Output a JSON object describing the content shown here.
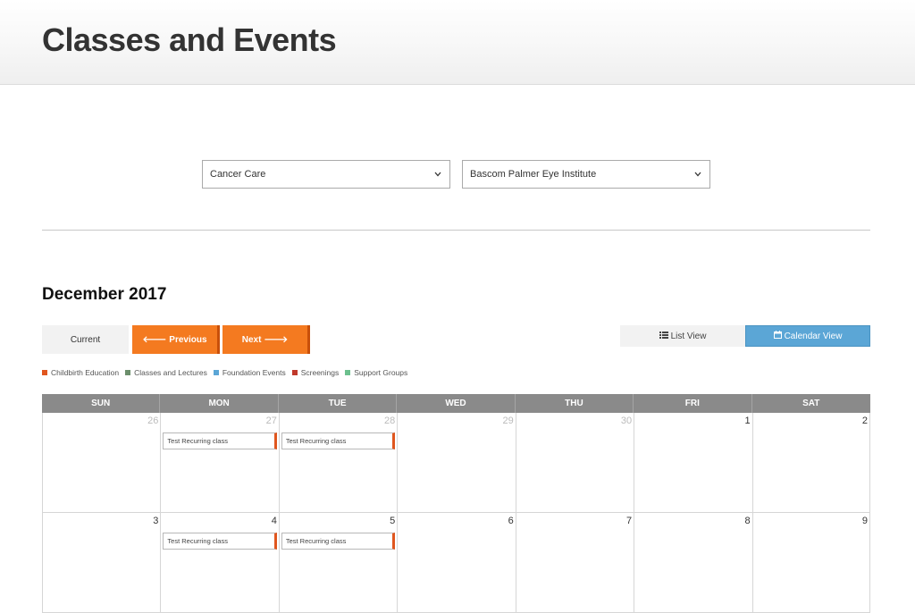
{
  "header": {
    "title": "Classes and Events"
  },
  "filters": {
    "category": "Cancer Care",
    "location": "Bascom Palmer Eye Institute"
  },
  "calendar": {
    "month_title": "December 2017",
    "buttons": {
      "current": "Current",
      "previous": "Previous",
      "next": "Next",
      "list_view": "List View",
      "calendar_view": "Calendar View"
    },
    "legend": [
      {
        "label": "Childbirth Education",
        "color": "#e0561e"
      },
      {
        "label": "Classes and Lectures",
        "color": "#6c8f6c"
      },
      {
        "label": "Foundation Events",
        "color": "#5ba6d6"
      },
      {
        "label": "Screenings",
        "color": "#c0392b"
      },
      {
        "label": "Support Groups",
        "color": "#6cc08e"
      }
    ],
    "weekdays": [
      "SUN",
      "MON",
      "TUE",
      "WED",
      "THU",
      "FRI",
      "SAT"
    ],
    "weeks": [
      [
        {
          "day": "26",
          "muted": true,
          "event": ""
        },
        {
          "day": "27",
          "muted": true,
          "event": "Test Recurring class"
        },
        {
          "day": "28",
          "muted": true,
          "event": "Test Recurring class"
        },
        {
          "day": "29",
          "muted": true,
          "event": ""
        },
        {
          "day": "30",
          "muted": true,
          "event": ""
        },
        {
          "day": "1",
          "muted": false,
          "event": ""
        },
        {
          "day": "2",
          "muted": false,
          "event": ""
        }
      ],
      [
        {
          "day": "3",
          "muted": false,
          "event": ""
        },
        {
          "day": "4",
          "muted": false,
          "event": "Test Recurring class"
        },
        {
          "day": "5",
          "muted": false,
          "event": "Test Recurring class"
        },
        {
          "day": "6",
          "muted": false,
          "event": ""
        },
        {
          "day": "7",
          "muted": false,
          "event": ""
        },
        {
          "day": "8",
          "muted": false,
          "event": ""
        },
        {
          "day": "9",
          "muted": false,
          "event": ""
        }
      ]
    ]
  }
}
